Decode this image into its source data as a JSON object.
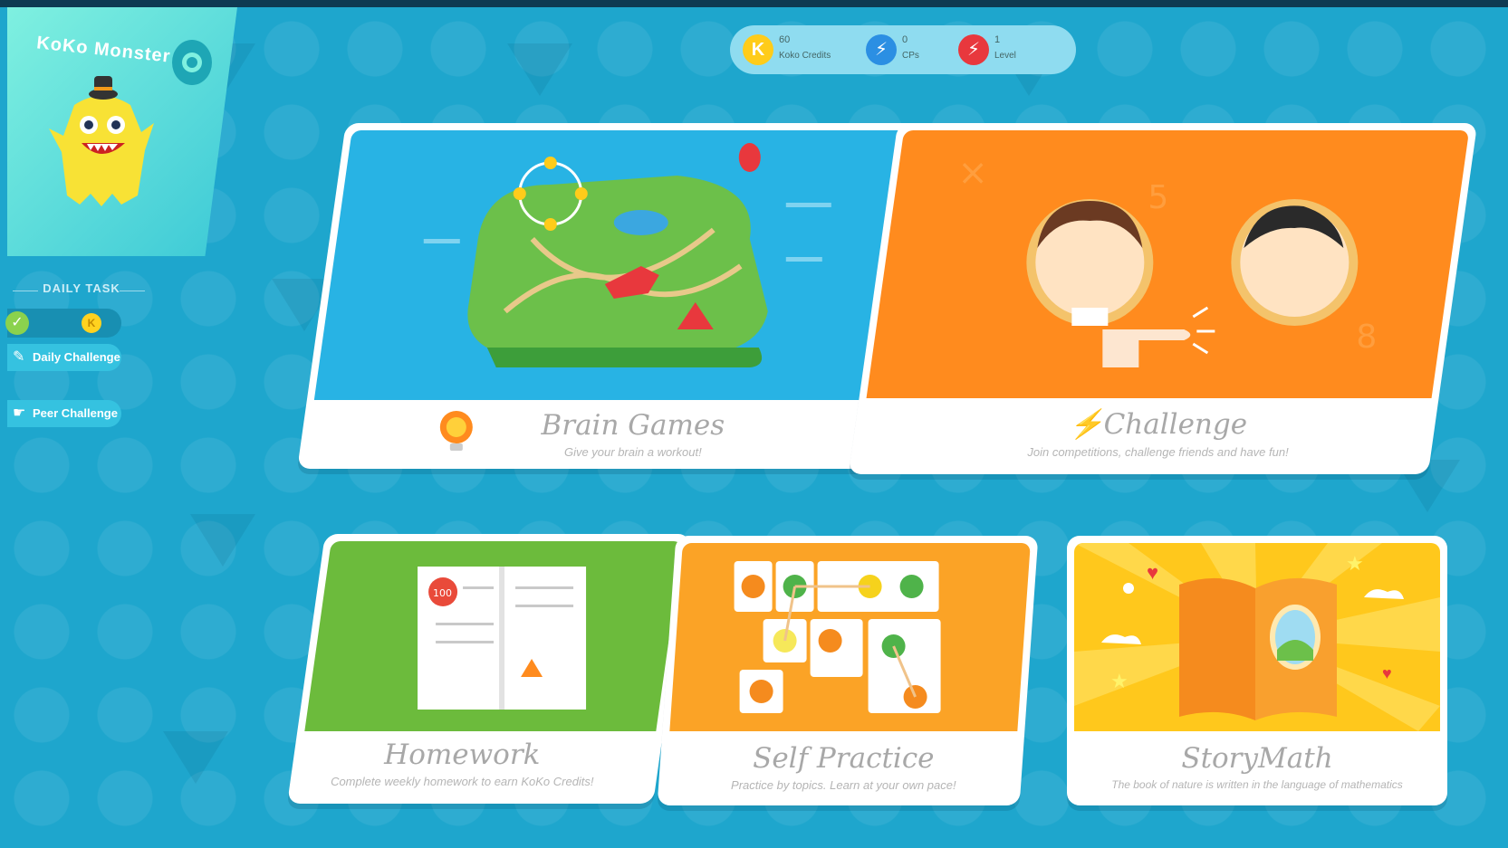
{
  "profile": {
    "name": "KoKo Monster"
  },
  "stats": [
    {
      "value": "60",
      "label": "Koko Credits",
      "icon": "coin-icon",
      "color": "#ffcc1a",
      "symbol": "K"
    },
    {
      "value": "0",
      "label": "CPs",
      "icon": "bolt-icon",
      "color": "#2b8fe3",
      "symbol": "⚡"
    },
    {
      "value": "1",
      "label": "Level",
      "icon": "level-bolt-icon",
      "color": "#e8383d",
      "symbol": "⚡"
    }
  ],
  "daily_task": {
    "heading": "DAILY TASK",
    "coin_symbol": "K",
    "buttons": [
      {
        "label": "Daily Challenge",
        "icon": "pencil-icon"
      },
      {
        "label": "Peer Challenge",
        "icon": "hand-point-icon"
      }
    ]
  },
  "cards": {
    "brain_games": {
      "title": "Brain Games",
      "subtitle": "Give your brain a workout!",
      "color": "#28b3e4"
    },
    "challenge": {
      "title": "Challenge",
      "subtitle": "Join competitions, challenge friends and have fun!",
      "color": "#ff8b1e"
    },
    "homework": {
      "title": "Homework",
      "subtitle": "Complete weekly homework to earn KoKo Credits!",
      "color": "#6cbb3c",
      "badge": "100"
    },
    "self_practice": {
      "title": "Self Practice",
      "subtitle": "Practice by topics. Learn at your own pace!",
      "color": "#fba326"
    },
    "story_math": {
      "title": "StoryMath",
      "subtitle": "The book of nature is written in the language of mathematics",
      "color": "#ffc81c"
    }
  }
}
